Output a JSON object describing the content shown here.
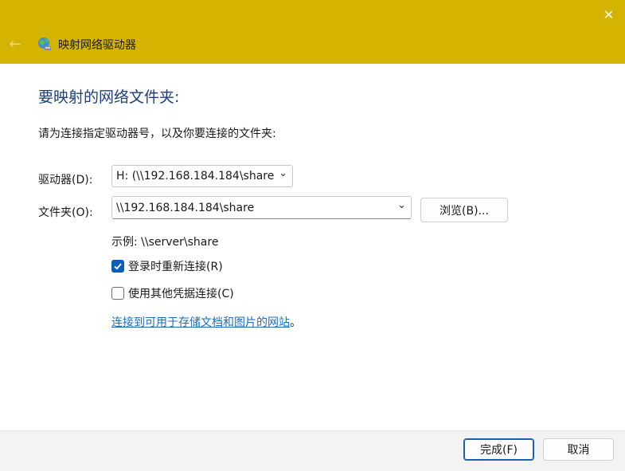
{
  "window": {
    "title": "映射网络驱动器",
    "accent": "#d4b400",
    "close_symbol": "✕",
    "back_symbol": "←"
  },
  "main": {
    "heading": "要映射的网络文件夹:",
    "instruction": "请为连接指定驱动器号，以及你要连接的文件夹:",
    "drive_label": "驱动器(D):",
    "drive_value": "H: (\\\\192.168.184.184\\share",
    "folder_label": "文件夹(O):",
    "folder_value": "\\\\192.168.184.184\\share",
    "browse_label": "浏览(B)...",
    "example_text": "示例: \\\\server\\share",
    "reconnect_label": "登录时重新连接(R)",
    "reconnect_checked": true,
    "other_credentials_label": "使用其他凭据连接(C)",
    "other_credentials_checked": false,
    "link_text": "连接到可用于存储文档和图片的网站",
    "link_suffix": "。"
  },
  "footer": {
    "finish_label": "完成(F)",
    "cancel_label": "取消"
  }
}
